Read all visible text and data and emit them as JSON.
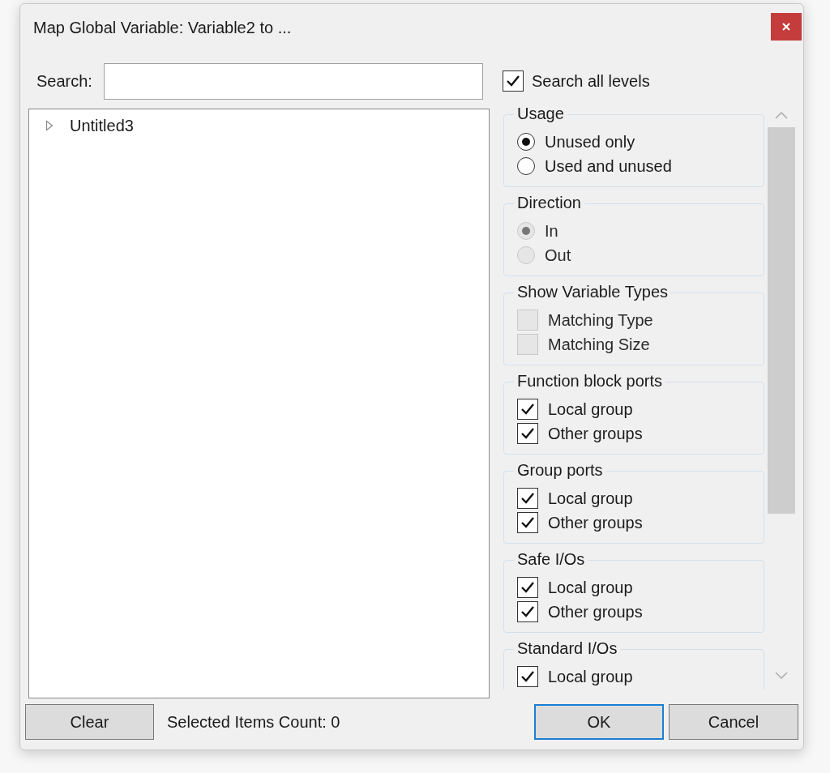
{
  "window": {
    "title": "Map Global Variable: Variable2 to ..."
  },
  "search": {
    "label": "Search:"
  },
  "search_all_levels": {
    "label": "Search all levels",
    "checked": true
  },
  "tree": [
    {
      "label": "Untitled3",
      "expanded": false
    }
  ],
  "option_groups": [
    {
      "title": "Usage",
      "kind": "radio",
      "options": [
        {
          "label": "Unused only",
          "selected": true,
          "disabled": false
        },
        {
          "label": "Used and unused",
          "selected": false,
          "disabled": false
        }
      ]
    },
    {
      "title": "Direction",
      "kind": "radio",
      "options": [
        {
          "label": "In",
          "selected": true,
          "disabled": true
        },
        {
          "label": "Out",
          "selected": false,
          "disabled": true
        }
      ]
    },
    {
      "title": "Show Variable Types",
      "kind": "checkbox",
      "options": [
        {
          "label": "Matching Type",
          "checked": false,
          "disabled": true
        },
        {
          "label": "Matching Size",
          "checked": false,
          "disabled": true
        }
      ]
    },
    {
      "title": "Function block ports",
      "kind": "checkbox",
      "options": [
        {
          "label": "Local group",
          "checked": true,
          "disabled": false
        },
        {
          "label": "Other groups",
          "checked": true,
          "disabled": false
        }
      ]
    },
    {
      "title": "Group ports",
      "kind": "checkbox",
      "options": [
        {
          "label": "Local group",
          "checked": true,
          "disabled": false
        },
        {
          "label": "Other groups",
          "checked": true,
          "disabled": false
        }
      ]
    },
    {
      "title": "Safe I/Os",
      "kind": "checkbox",
      "options": [
        {
          "label": "Local group",
          "checked": true,
          "disabled": false
        },
        {
          "label": "Other groups",
          "checked": true,
          "disabled": false
        }
      ]
    },
    {
      "title": "Standard I/Os",
      "kind": "checkbox",
      "options": [
        {
          "label": "Local group",
          "checked": true,
          "disabled": false
        }
      ]
    }
  ],
  "buttons": {
    "clear": "Clear",
    "ok": "OK",
    "cancel": "Cancel"
  },
  "status": "Selected Items Count: 0"
}
